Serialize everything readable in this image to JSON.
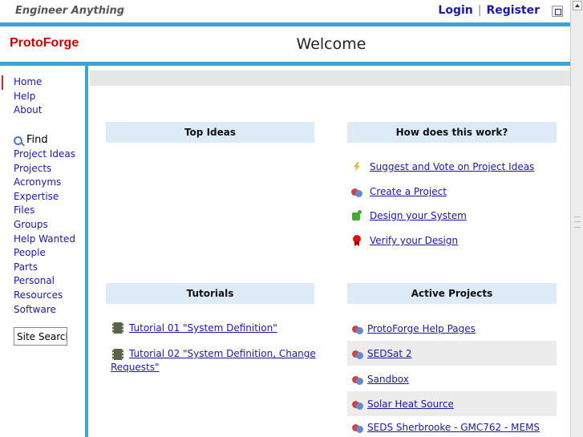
{
  "topbar": {
    "tagline": "Engineer Anything",
    "login": "Login",
    "separator": "|",
    "register": "Register"
  },
  "header": {
    "logo": "ProtoForge",
    "title": "Welcome"
  },
  "sidebar": {
    "nav": [
      "Home",
      "Help",
      "About"
    ],
    "find_label": "Find",
    "find_items": [
      "Project Ideas",
      "Projects",
      "Acronyms",
      "Expertise",
      "Files",
      "Groups",
      "Help Wanted",
      "People",
      "Parts",
      "Personal",
      "Resources",
      "Software"
    ],
    "search_button": "Site Search"
  },
  "top_ideas": {
    "title": "Top Ideas"
  },
  "how": {
    "title": "How does this work?",
    "items": [
      {
        "label": "Suggest and Vote on Project Ideas",
        "icon": "lightning-icon"
      },
      {
        "label": "Create a Project",
        "icon": "gears-icon"
      },
      {
        "label": "Design your System",
        "icon": "puzzle-icon"
      },
      {
        "label": "Verify your Design",
        "icon": "ribbon-icon"
      }
    ]
  },
  "tutorials": {
    "title": "Tutorials",
    "items": [
      "Tutorial 01 \"System Definition\"",
      "Tutorial 02 \"System Definition, Change Requests\""
    ]
  },
  "active_projects": {
    "title": "Active Projects",
    "items": [
      "ProtoForge Help Pages",
      "SEDSat 2",
      "Sandbox",
      "Solar Heat Source",
      "SEDS Sherbrooke - GMC762 - MEMS"
    ]
  }
}
